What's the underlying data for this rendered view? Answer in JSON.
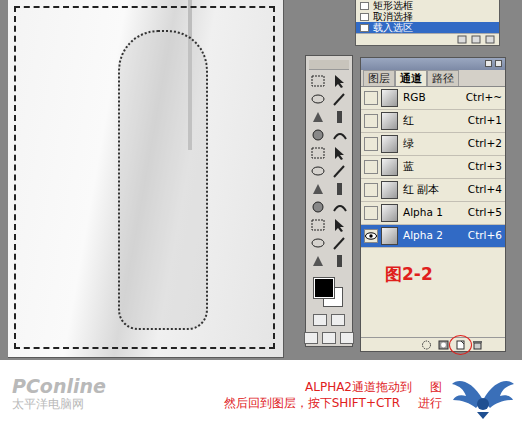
{
  "history": {
    "items": [
      {
        "label": "矩形选框",
        "selected": false
      },
      {
        "label": "取消选择",
        "selected": false
      },
      {
        "label": "载入选区",
        "selected": true
      }
    ]
  },
  "channels_panel": {
    "tabs": [
      {
        "label": "图层",
        "selected": false
      },
      {
        "label": "通道",
        "selected": true
      },
      {
        "label": "路径",
        "selected": false
      }
    ],
    "channels": [
      {
        "name": "RGB",
        "shortcut": "Ctrl+~",
        "visible": false,
        "selected": false
      },
      {
        "name": "红",
        "shortcut": "Ctrl+1",
        "visible": false,
        "selected": false
      },
      {
        "name": "绿",
        "shortcut": "Ctrl+2",
        "visible": false,
        "selected": false
      },
      {
        "name": "蓝",
        "shortcut": "Ctrl+3",
        "visible": false,
        "selected": false
      },
      {
        "name": "红 副本",
        "shortcut": "Ctrl+4",
        "visible": false,
        "selected": false
      },
      {
        "name": "Alpha 1",
        "shortcut": "Ctrl+5",
        "visible": false,
        "selected": false
      },
      {
        "name": "Alpha 2",
        "shortcut": "Ctrl+6",
        "visible": true,
        "selected": true
      }
    ]
  },
  "figure_label": "图2-2",
  "caption": {
    "lines": [
      {
        "parts": [
          "ALPHA2通道拖动到",
          "图"
        ]
      },
      {
        "parts": [
          "然后回到图层，按下SHIFT+CTR",
          "进行"
        ]
      }
    ]
  },
  "watermark": {
    "brand": "PConline",
    "site": "太平洋电脑网"
  }
}
